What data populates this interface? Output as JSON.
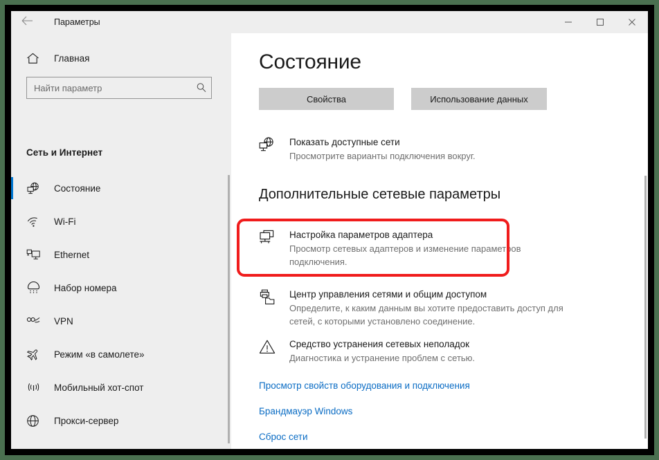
{
  "window": {
    "title": "Параметры",
    "back_icon": "back-arrow-icon",
    "minimize_label": "Свернуть",
    "maximize_label": "Развернуть",
    "close_label": "Закрыть"
  },
  "sidebar": {
    "home_label": "Главная",
    "home_icon": "home-icon",
    "search": {
      "placeholder": "Найти параметр",
      "value": "",
      "icon": "search-icon"
    },
    "heading": "Сеть и Интернет",
    "items": [
      {
        "label": "Состояние",
        "icon": "network-status-icon",
        "selected": true
      },
      {
        "label": "Wi-Fi",
        "icon": "wifi-icon",
        "selected": false
      },
      {
        "label": "Ethernet",
        "icon": "ethernet-icon",
        "selected": false
      },
      {
        "label": "Набор номера",
        "icon": "dial-up-icon",
        "selected": false
      },
      {
        "label": "VPN",
        "icon": "vpn-icon",
        "selected": false
      },
      {
        "label": "Режим «в самолете»",
        "icon": "airplane-mode-icon",
        "selected": false
      },
      {
        "label": "Мобильный хот-спот",
        "icon": "mobile-hotspot-icon",
        "selected": false
      },
      {
        "label": "Прокси-сервер",
        "icon": "proxy-globe-icon",
        "selected": false
      }
    ]
  },
  "main": {
    "page_title": "Состояние",
    "buttons": {
      "properties": "Свойства",
      "data_usage": "Использование данных"
    },
    "show_networks": {
      "title": "Показать доступные сети",
      "desc": "Просмотрите варианты подключения вокруг.",
      "icon": "globe-monitor-icon"
    },
    "advanced_heading": "Дополнительные сетевые параметры",
    "entries": [
      {
        "title": "Настройка параметров адаптера",
        "desc": "Просмотр сетевых адаптеров и изменение параметров подключения.",
        "icon": "adapter-settings-icon",
        "highlighted": true
      },
      {
        "title": "Центр управления сетями и общим доступом",
        "desc": "Определите, к каким данным вы хотите предоставить доступ для сетей, с которыми установлено соединение.",
        "icon": "network-sharing-center-icon",
        "highlighted": false
      },
      {
        "title": "Средство устранения сетевых неполадок",
        "desc": "Диагностика и устранение проблем с сетью.",
        "icon": "warning-triangle-icon",
        "highlighted": false
      }
    ],
    "links": [
      "Просмотр свойств оборудования и подключения",
      "Брандмауэр Windows",
      "Сброс сети"
    ]
  },
  "annotation": {
    "highlight_color": "#f01c1c"
  },
  "colors": {
    "accent": "#0078d4",
    "link": "#0a6cc4",
    "sidebar_bg": "#eeeeee",
    "outer_frame": "#4a7050"
  }
}
